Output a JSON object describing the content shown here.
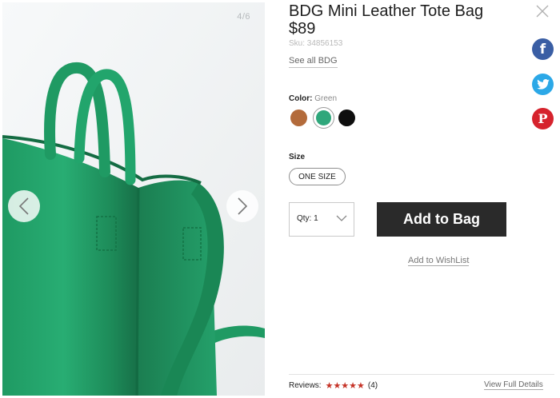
{
  "product": {
    "title": "BDG Mini Leather Tote Bag",
    "price": "$89",
    "sku": "Sku: 34856153",
    "see_all": "See all BDG"
  },
  "gallery": {
    "counter": "4/6",
    "prev_icon": "chevron-left-icon",
    "next_icon": "chevron-right-icon"
  },
  "color": {
    "label": "Color:",
    "selected": "Green",
    "swatches": [
      {
        "name": "Brown",
        "hex": "#b36b3b"
      },
      {
        "name": "Green",
        "hex": "#2fa77b"
      },
      {
        "name": "Black",
        "hex": "#0e0e0e"
      }
    ]
  },
  "size": {
    "label": "Size",
    "option": "ONE SIZE"
  },
  "quantity": {
    "label": "Qty: 1"
  },
  "actions": {
    "add_to_bag": "Add to Bag",
    "wishlist": "Add to WishList"
  },
  "social": {
    "facebook": "f",
    "pinterest": "P"
  },
  "reviews": {
    "label": "Reviews:",
    "stars": "★★★★★",
    "rating": 5,
    "count": "(4)",
    "full_details": "View Full Details"
  },
  "colors": {
    "button_dark": "#2a2a2a",
    "facebook": "#3a5ea4",
    "twitter": "#2ca8e7",
    "pinterest": "#d6232d",
    "stars": "#c53226"
  }
}
